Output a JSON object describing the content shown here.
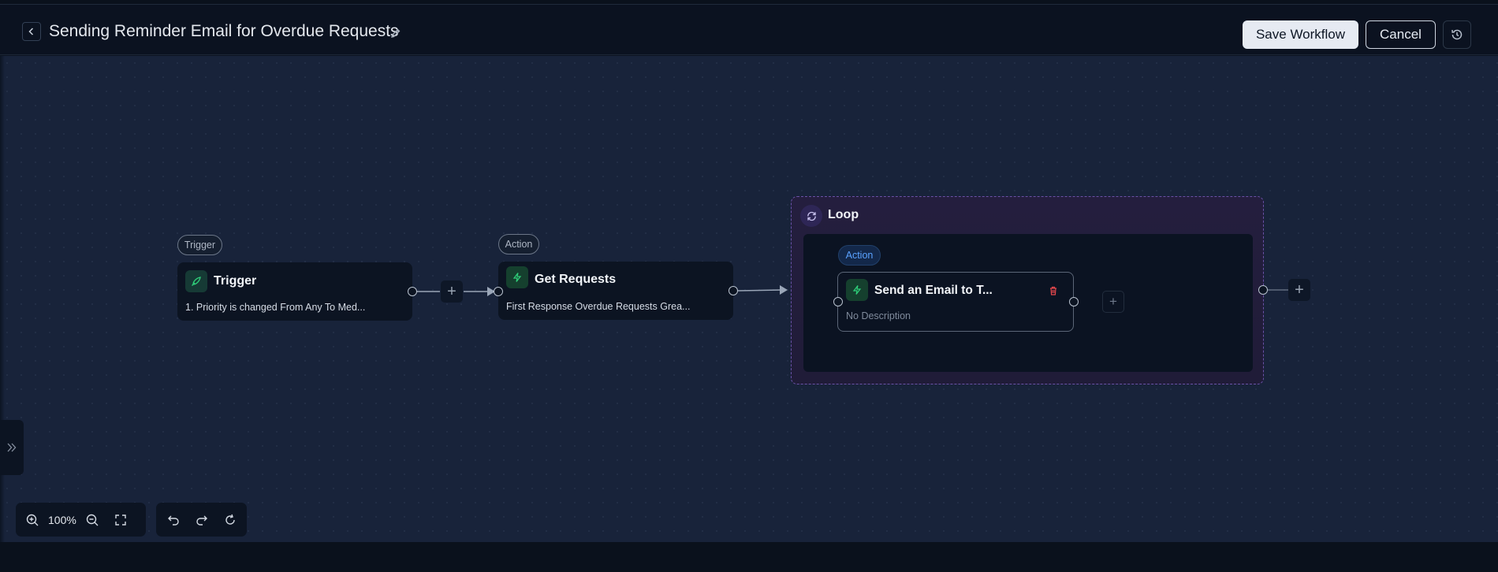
{
  "header": {
    "title": "Sending Reminder Email for Overdue Requests",
    "save_label": "Save Workflow",
    "cancel_label": "Cancel"
  },
  "nodes": {
    "trigger": {
      "tag": "Trigger",
      "title": "Trigger",
      "description": "1. Priority is changed From Any To Med..."
    },
    "get_requests": {
      "tag": "Action",
      "title": "Get Requests",
      "description": "First Response Overdue Requests Grea..."
    },
    "loop": {
      "title": "Loop",
      "inner_tag": "Action",
      "inner_title": "Send an Email to T...",
      "inner_description": "No Description"
    }
  },
  "toolbar": {
    "zoom_level": "100%"
  },
  "colors": {
    "canvas_bg": "#18233a",
    "accent_green": "#2fd07a",
    "loop_border": "#6a52a8",
    "action_tag_blue": "#5aa2ff",
    "delete_red": "#e5484d"
  },
  "icons": {
    "back": "chevron-left-icon",
    "edit": "pencil-icon",
    "history": "history-icon",
    "trigger": "rocket-icon",
    "action": "lightning-icon",
    "loop": "refresh-icon",
    "delete": "trash-icon"
  }
}
